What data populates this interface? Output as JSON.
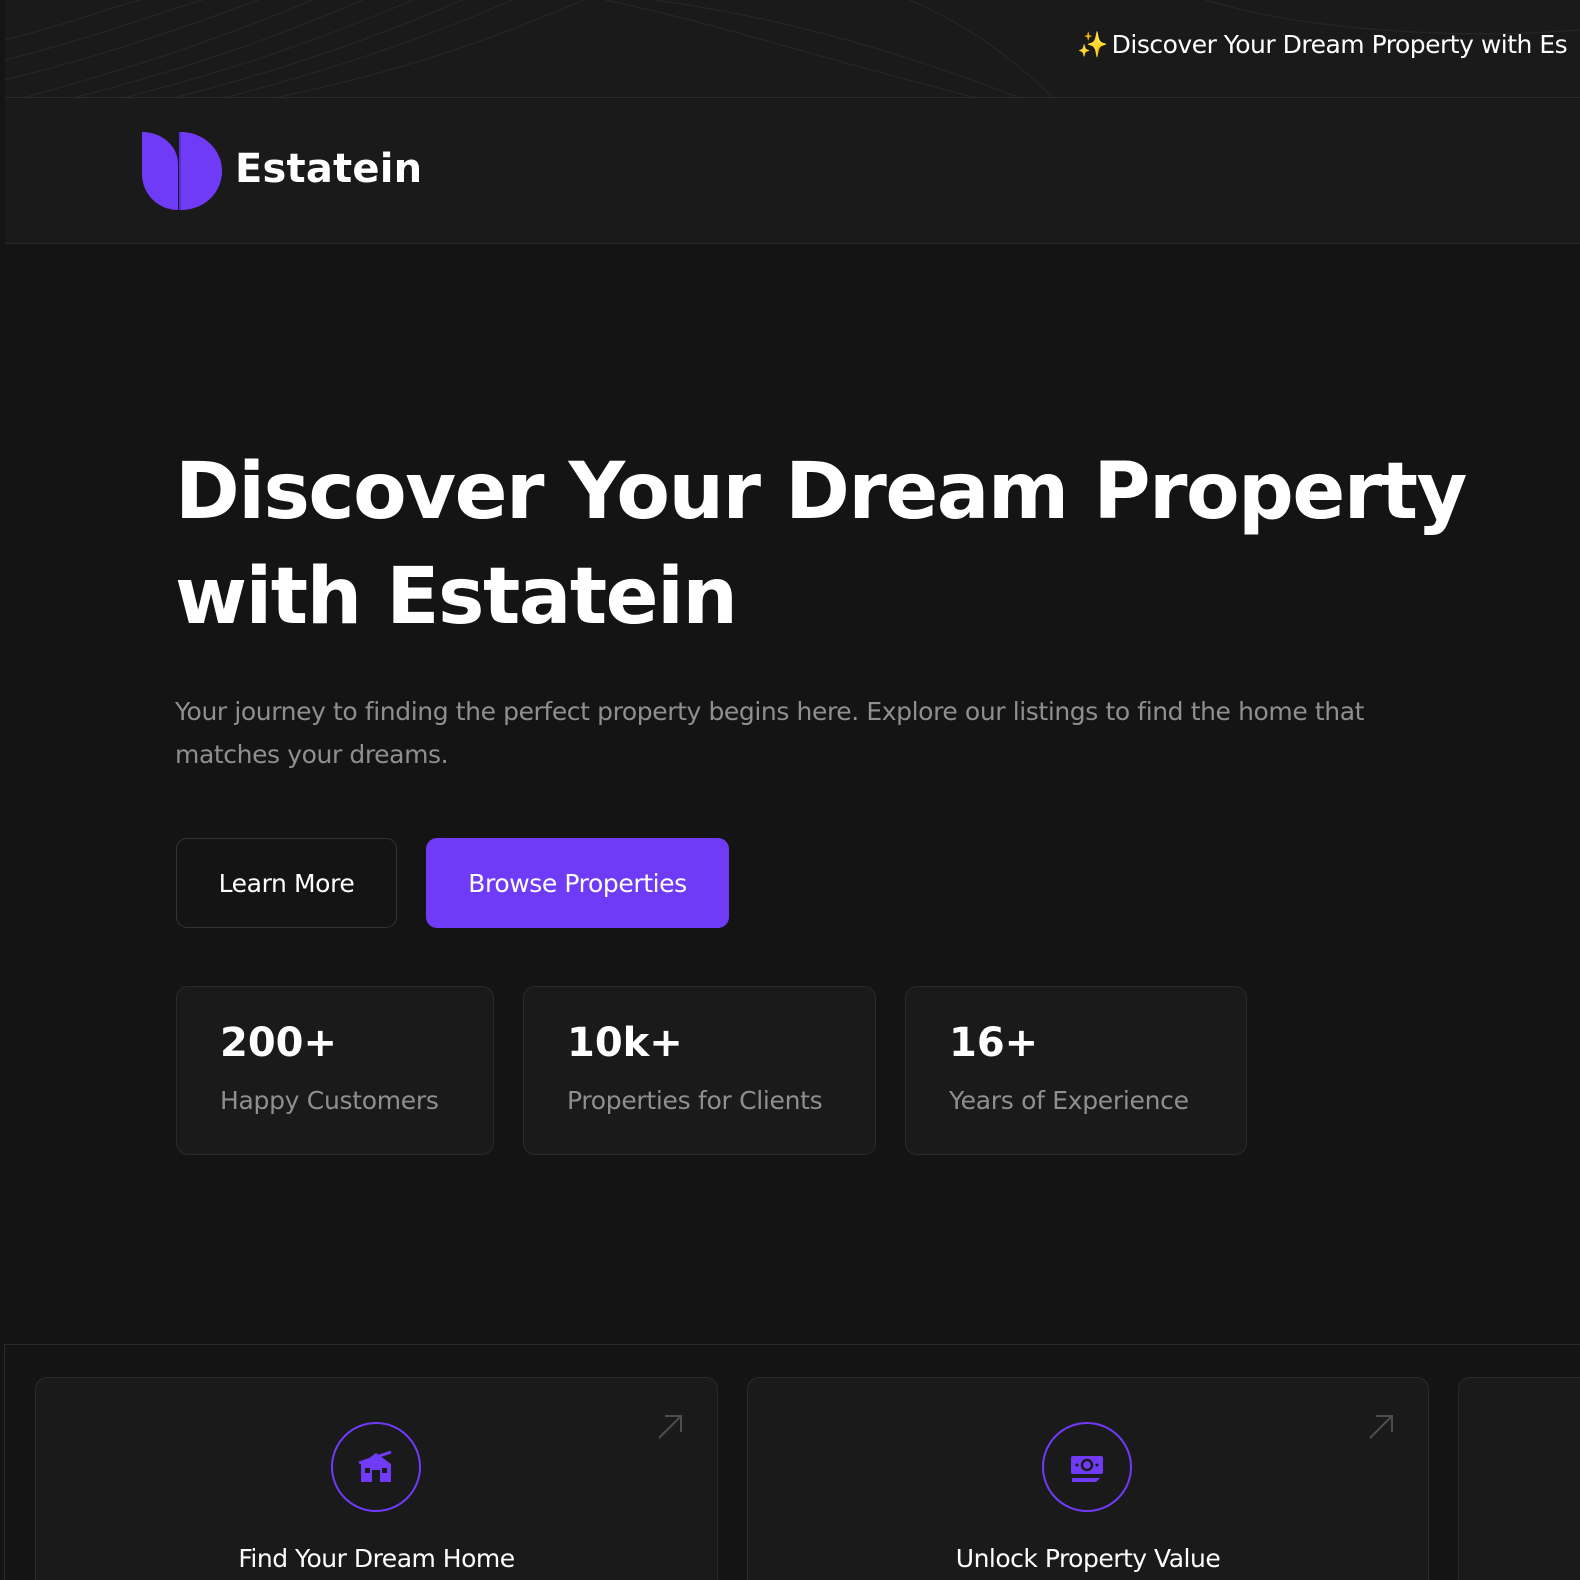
{
  "banner": {
    "spark_icon": "✨",
    "text": "Discover Your Dream Property with Es"
  },
  "header": {
    "brand": "Estatein",
    "brand_color": "#703bf7"
  },
  "hero": {
    "title_line1": "Discover Your Dream Property",
    "title_line2": "with Estatein",
    "description": "Your journey to finding the perfect property begins here. Explore our listings to find the home that matches your dreams.",
    "learn_more_label": "Learn More",
    "browse_label": "Browse Properties"
  },
  "stats": [
    {
      "value": "200+",
      "label": "Happy Customers"
    },
    {
      "value": "10k+",
      "label": "Properties for Clients"
    },
    {
      "value": "16+",
      "label": "Years of Experience"
    }
  ],
  "features": [
    {
      "title": "Find Your Dream Home",
      "icon": "house-icon"
    },
    {
      "title": "Unlock Property Value",
      "icon": "money-icon"
    }
  ],
  "colors": {
    "background": "#141414",
    "surface": "#1a1a1a",
    "accent": "#703bf7",
    "muted_text": "#8f8f8f",
    "border": "#2a2a2a"
  }
}
